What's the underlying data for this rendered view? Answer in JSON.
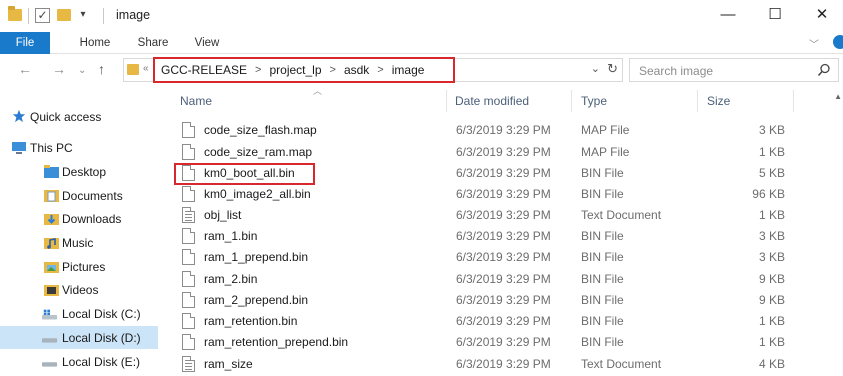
{
  "window": {
    "title": "image",
    "minimize": "—",
    "maximize": "☐",
    "close": "✕"
  },
  "ribbon": {
    "tabs": [
      "File",
      "Home",
      "Share",
      "View"
    ]
  },
  "address": {
    "crumbs": [
      "GCC-RELEASE",
      "project_lp",
      "asdk",
      "image"
    ],
    "separator": ">"
  },
  "search": {
    "placeholder": "Search image"
  },
  "nav_pane": {
    "items": [
      {
        "label": "Quick access",
        "icon": "star-icon"
      },
      {
        "label": "This PC",
        "icon": "computer-icon"
      },
      {
        "label": "Desktop",
        "icon": "desktop-folder-icon"
      },
      {
        "label": "Documents",
        "icon": "documents-folder-icon"
      },
      {
        "label": "Downloads",
        "icon": "downloads-folder-icon"
      },
      {
        "label": "Music",
        "icon": "music-folder-icon"
      },
      {
        "label": "Pictures",
        "icon": "pictures-folder-icon"
      },
      {
        "label": "Videos",
        "icon": "videos-folder-icon"
      },
      {
        "label": "Local Disk (C:)",
        "icon": "windows-drive-icon"
      },
      {
        "label": "Local Disk (D:)",
        "icon": "drive-icon",
        "selected": true
      },
      {
        "label": "Local Disk (E:)",
        "icon": "drive-icon"
      }
    ]
  },
  "file_list": {
    "columns": [
      "Name",
      "Date modified",
      "Type",
      "Size"
    ],
    "rows": [
      {
        "name": "code_size_flash.map",
        "date": "6/3/2019 3:29 PM",
        "type": "MAP File",
        "size": "3 KB",
        "icon": "file-icon"
      },
      {
        "name": "code_size_ram.map",
        "date": "6/3/2019 3:29 PM",
        "type": "MAP File",
        "size": "1 KB",
        "icon": "file-icon"
      },
      {
        "name": "km0_boot_all.bin",
        "date": "6/3/2019 3:29 PM",
        "type": "BIN File",
        "size": "5 KB",
        "icon": "file-icon"
      },
      {
        "name": "km0_image2_all.bin",
        "date": "6/3/2019 3:29 PM",
        "type": "BIN File",
        "size": "96 KB",
        "icon": "file-icon"
      },
      {
        "name": "obj_list",
        "date": "6/3/2019 3:29 PM",
        "type": "Text Document",
        "size": "1 KB",
        "icon": "text-file-icon"
      },
      {
        "name": "ram_1.bin",
        "date": "6/3/2019 3:29 PM",
        "type": "BIN File",
        "size": "3 KB",
        "icon": "file-icon"
      },
      {
        "name": "ram_1_prepend.bin",
        "date": "6/3/2019 3:29 PM",
        "type": "BIN File",
        "size": "3 KB",
        "icon": "file-icon"
      },
      {
        "name": "ram_2.bin",
        "date": "6/3/2019 3:29 PM",
        "type": "BIN File",
        "size": "9 KB",
        "icon": "file-icon"
      },
      {
        "name": "ram_2_prepend.bin",
        "date": "6/3/2019 3:29 PM",
        "type": "BIN File",
        "size": "9 KB",
        "icon": "file-icon"
      },
      {
        "name": "ram_retention.bin",
        "date": "6/3/2019 3:29 PM",
        "type": "BIN File",
        "size": "1 KB",
        "icon": "file-icon"
      },
      {
        "name": "ram_retention_prepend.bin",
        "date": "6/3/2019 3:29 PM",
        "type": "BIN File",
        "size": "1 KB",
        "icon": "file-icon"
      },
      {
        "name": "ram_size",
        "date": "6/3/2019 3:29 PM",
        "type": "Text Document",
        "size": "4 KB",
        "icon": "text-file-icon"
      }
    ]
  },
  "colors": {
    "accent": "#1979ca",
    "highlight": "#d9272e",
    "selection": "#cce4f7",
    "header_text": "#4c607a"
  }
}
